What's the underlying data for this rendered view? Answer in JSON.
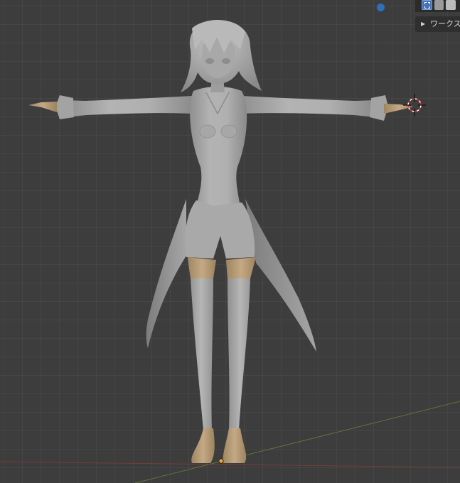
{
  "workspace_panel": {
    "label": "ワークス"
  },
  "icons": {
    "select_box": "select-box-icon",
    "mode_a": "mode-icon",
    "mode_b": "mode-icon",
    "expand": "triangle-right-icon",
    "record": "blue-dot-icon",
    "cursor": "3d-cursor-icon",
    "origin": "object-origin-icon"
  },
  "colors": {
    "background": "#3d3d3d",
    "grid": "#474747",
    "x_axis": "#8b3d3d",
    "y_axis": "#6d8a3a",
    "model_skin": "#a9a9a9",
    "model_tan": "#b49a72",
    "accent_blue": "#2f6fba"
  }
}
